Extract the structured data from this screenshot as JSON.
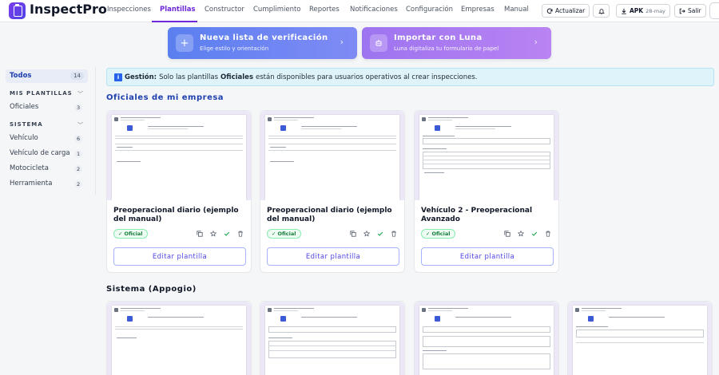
{
  "app": {
    "name": "InspectPro"
  },
  "nav": {
    "items": [
      {
        "label": "Inspecciones"
      },
      {
        "label": "Plantillas",
        "active": true
      },
      {
        "label": "Constructor"
      },
      {
        "label": "Cumplimiento"
      },
      {
        "label": "Reportes"
      },
      {
        "label": "Notificaciones"
      },
      {
        "label": "Configuración"
      },
      {
        "label": "Empresas"
      },
      {
        "label": "Manual"
      }
    ],
    "refresh_label": "Actualizar",
    "apk_label": "APK",
    "apk_date": "28-may",
    "logout_label": "Salir"
  },
  "hero": {
    "new_list": {
      "title": "Nueva lista de verificación",
      "subtitle": "Elige estilo y orientación"
    },
    "import": {
      "title": "Importar con Luna",
      "subtitle": "Luna digitaliza tu formulario de papel"
    }
  },
  "sidebar": {
    "all": {
      "label": "Todos",
      "count": "14"
    },
    "my_templates": {
      "title": "MIS PLANTILLAS",
      "items": [
        {
          "label": "Oficiales",
          "count": "3"
        }
      ]
    },
    "system": {
      "title": "SISTEMA",
      "items": [
        {
          "label": "Vehículo",
          "count": "6"
        },
        {
          "label": "Vehículo de carga",
          "count": "1"
        },
        {
          "label": "Motocicleta",
          "count": "2"
        },
        {
          "label": "Herramienta",
          "count": "2"
        }
      ]
    }
  },
  "banner": {
    "prefix": "Gestión:",
    "text_before": "Solo las plantillas",
    "highlight": "Oficiales",
    "text_after": "están disponibles para usuarios operativos al crear inspecciones."
  },
  "sections": {
    "official": {
      "title": "Oficiales de mi empresa",
      "cards": [
        {
          "title": "Preoperacional diario (ejemplo del manual)",
          "badge": "Oficial",
          "edit_label": "Editar plantilla"
        },
        {
          "title": "Preoperacional diario (ejemplo del manual)",
          "badge": "Oficial",
          "edit_label": "Editar plantilla"
        },
        {
          "title": "Vehículo 2 - Preoperacional Avanzado",
          "badge": "Oficial",
          "edit_label": "Editar plantilla"
        }
      ]
    },
    "system": {
      "title": "Sistema (Appogio)"
    }
  },
  "colors": {
    "accent": "#6d28d9",
    "link_blue": "#1e40af",
    "hero_blue": "#5b7ff0",
    "hero_purple": "#9d74f0",
    "badge_green": "#15803d",
    "banner_bg": "#dff3fa"
  },
  "icons": {
    "refresh": "refresh-icon",
    "bell": "bell-icon",
    "download": "download-icon",
    "logout": "logout-icon",
    "plus": "plus-icon",
    "luna": "luna-icon",
    "copy": "copy-icon",
    "star": "star-icon",
    "check": "check-icon",
    "trash": "trash-icon",
    "info": "info-icon"
  }
}
